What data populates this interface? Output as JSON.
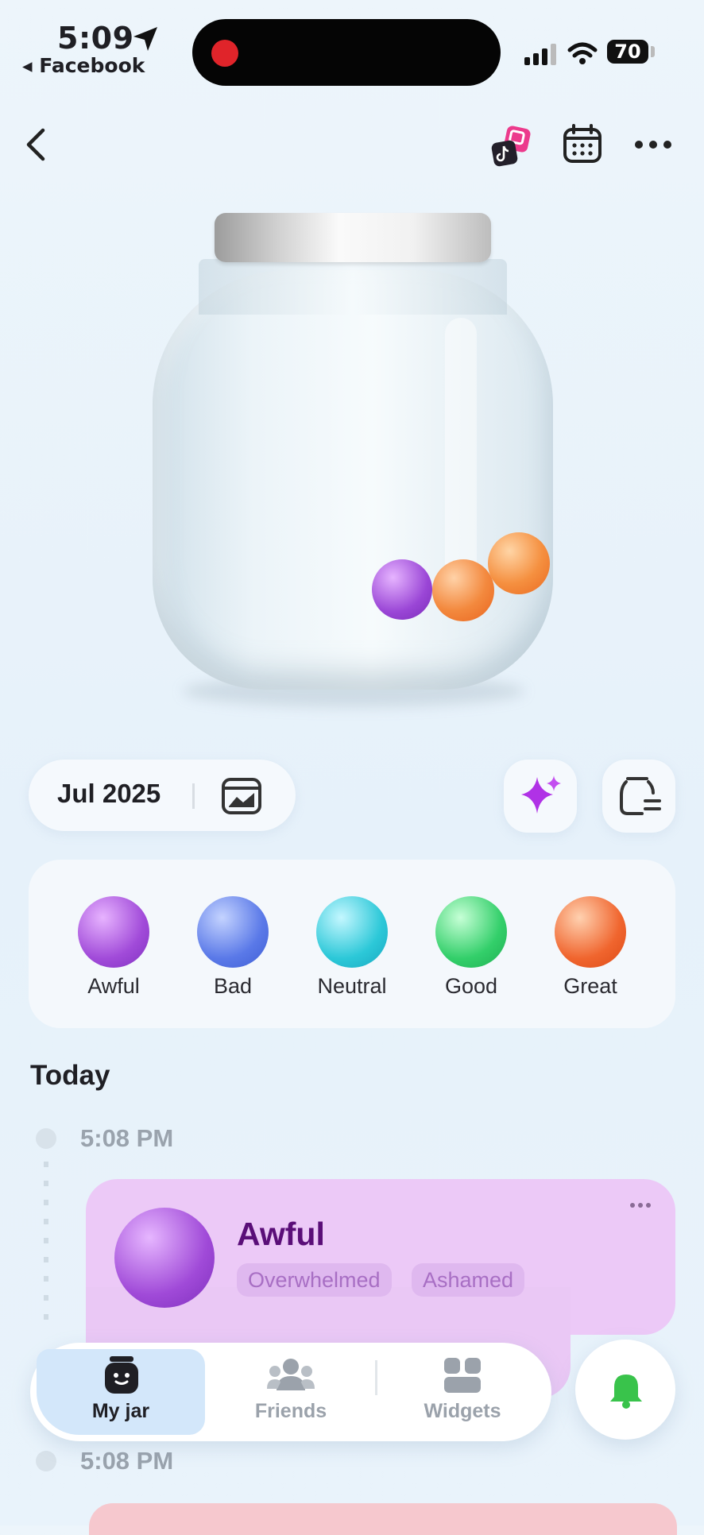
{
  "status_bar": {
    "time": "5:09",
    "back_app": "◂ Facebook",
    "battery": "70"
  },
  "header": {
    "back_icon": "chevron-left-icon",
    "icons": [
      "app-stickers-icon",
      "calendar-icon",
      "more-icon"
    ]
  },
  "jar": {
    "marbles": [
      "awful",
      "great",
      "great"
    ]
  },
  "controls": {
    "month": "Jul 2025",
    "stats_icon": "chart-card-icon",
    "sparkle_icon": "sparkles-icon",
    "jar_switch_icon": "jar-switch-icon"
  },
  "moods": [
    {
      "label": "Awful",
      "color": "#a14bd9"
    },
    {
      "label": "Bad",
      "color": "#5a79e8"
    },
    {
      "label": "Neutral",
      "color": "#2cc8d8"
    },
    {
      "label": "Good",
      "color": "#33cf6a"
    },
    {
      "label": "Great",
      "color": "#f0652e"
    }
  ],
  "timeline": {
    "section_title": "Today",
    "entries": [
      {
        "time": "5:08 PM",
        "mood": "Awful",
        "tags": [
          "Overwhelmed",
          "Ashamed"
        ],
        "color": "#ecc9f7"
      },
      {
        "time": "5:08 PM"
      }
    ]
  },
  "nav": {
    "items": [
      {
        "label": "My jar",
        "icon": "jar-face-icon",
        "selected": true
      },
      {
        "label": "Friends",
        "icon": "friends-icon",
        "selected": false
      },
      {
        "label": "Widgets",
        "icon": "widgets-icon",
        "selected": false
      }
    ],
    "bell_icon": "bell-icon"
  }
}
